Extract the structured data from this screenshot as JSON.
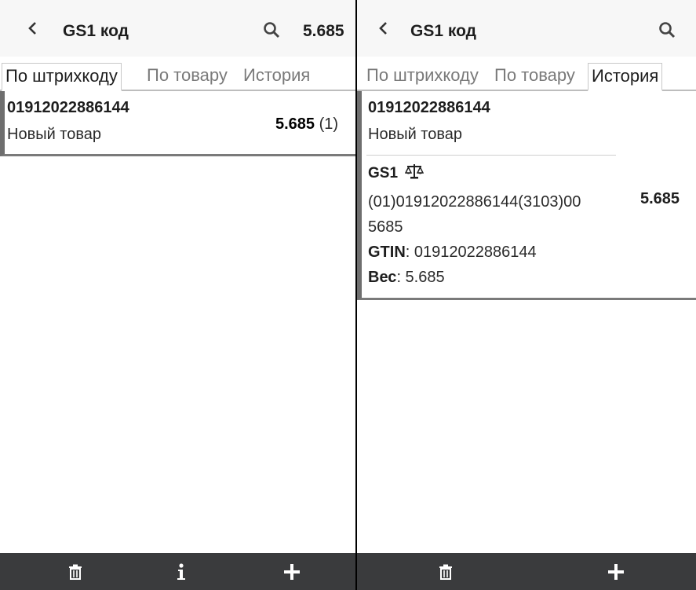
{
  "left": {
    "header": {
      "title": "GS1 код",
      "value": "5.685"
    },
    "tabs": [
      {
        "label": "По штрихкоду",
        "active": true
      },
      {
        "label": "По товару",
        "active": false
      },
      {
        "label": "История",
        "active": false
      }
    ],
    "item": {
      "code": "01912022886144",
      "name": "Новый товар",
      "qty": "5.685",
      "count": "(1)"
    },
    "footer": {
      "icons": [
        "trash-icon",
        "info-icon",
        "plus-icon"
      ]
    }
  },
  "right": {
    "header": {
      "title": "GS1 код"
    },
    "tabs": [
      {
        "label": "По штрихкоду",
        "active": false
      },
      {
        "label": "По товару",
        "active": false
      },
      {
        "label": "История",
        "active": true
      }
    ],
    "item": {
      "code": "01912022886144",
      "name": "Новый товар",
      "gs1_label": "GS1",
      "gs1_icon": "scale-icon",
      "barcode_line1": "(01)01912022886144(3103)00",
      "barcode_line2": "5685",
      "gtin_label": "GTIN",
      "gtin_value": ": 01912022886144",
      "weight_label": "Вес",
      "weight_value": ": 5.685",
      "qty": "5.685"
    },
    "footer": {
      "icons": [
        "trash-icon",
        "plus-icon"
      ]
    }
  },
  "colors": {
    "footer": "#3a3b3d",
    "card_border": "#6e6e6e",
    "header_bg": "#f7f7f7"
  }
}
